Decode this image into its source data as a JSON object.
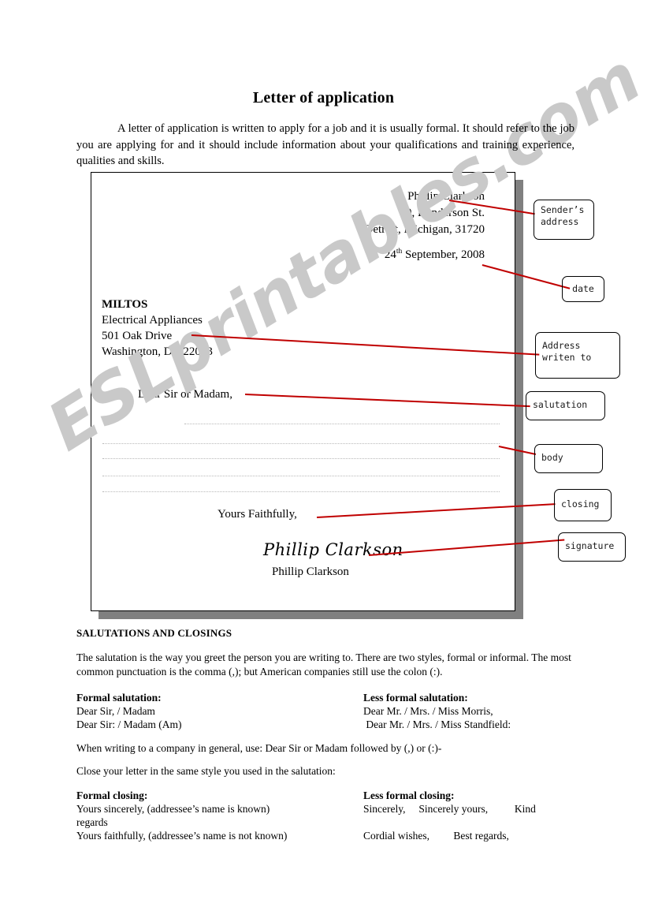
{
  "title": "Letter of application",
  "intro": "A letter of application is written to apply for a job and it is usually formal. It should refer to the job you are applying for and it should include information about your qualifications and training experience, qualities and skills.",
  "watermark": "ESLprintables.com",
  "letter": {
    "sender_address": [
      "Phillip Clarkson",
      "19, Henderson St.",
      "Detroit, Michigan, 31720"
    ],
    "date_day": "24",
    "date_sup": "th",
    "date_rest": " September, 2008",
    "recipient": [
      "MILTOS",
      "Electrical Appliances",
      "501 Oak Drive",
      "Washington, DC 22063"
    ],
    "salutation": "Dear Sir or Madam,",
    "closing": "Yours Faithfully,",
    "signature_script": "Phillip Clarkson",
    "signature_print": "Phillip Clarkson",
    "body_line_count": 5
  },
  "callouts": [
    {
      "id": "senders-address",
      "label": "Sender’s\naddress"
    },
    {
      "id": "date",
      "label": "date"
    },
    {
      "id": "address-writen-to",
      "label": "Address\nwriten to"
    },
    {
      "id": "salutation",
      "label": "salutation"
    },
    {
      "id": "body",
      "label": "body"
    },
    {
      "id": "closing",
      "label": "closing"
    },
    {
      "id": "signature",
      "label": "signature"
    }
  ],
  "lower": {
    "section_heading": "SALUTATIONS AND CLOSINGS",
    "salutation_intro": "The salutation is the way you greet the person you are writing to. There are two styles, formal or informal.  The most common punctuation is the comma (,); but American companies still use the colon (:).",
    "formal_salutation": {
      "heading": "Formal salutation:",
      "lines": [
        "Dear Sir, / Madam",
        "Dear Sir: / Madam (Am)"
      ]
    },
    "less_formal_salutation": {
      "heading": "Less formal salutation:",
      "lines": [
        "Dear Mr. / Mrs. / Miss Morris,",
        " Dear Mr. / Mrs. / Miss Standfield:"
      ]
    },
    "general_note": "When writing to a company in general, use: Dear Sir or Madam followed by (,) or (:)-",
    "close_note": "Close your letter in the same style you used in the salutation:",
    "formal_closing": {
      "heading": "Formal closing:",
      "lines": [
        "Yours sincerely, (addressee’s name is known)",
        "regards",
        "Yours faithfully, (addressee’s name is not known)"
      ]
    },
    "less_formal_closing": {
      "heading": "Less formal closing:",
      "lines": [
        "Sincerely,     Sincerely yours,          Kind",
        "",
        "Cordial wishes,         Best regards,"
      ]
    }
  },
  "colors": {
    "leader_line": "#c00000",
    "shadow": "#808080",
    "watermark": "#c9c9c9"
  }
}
